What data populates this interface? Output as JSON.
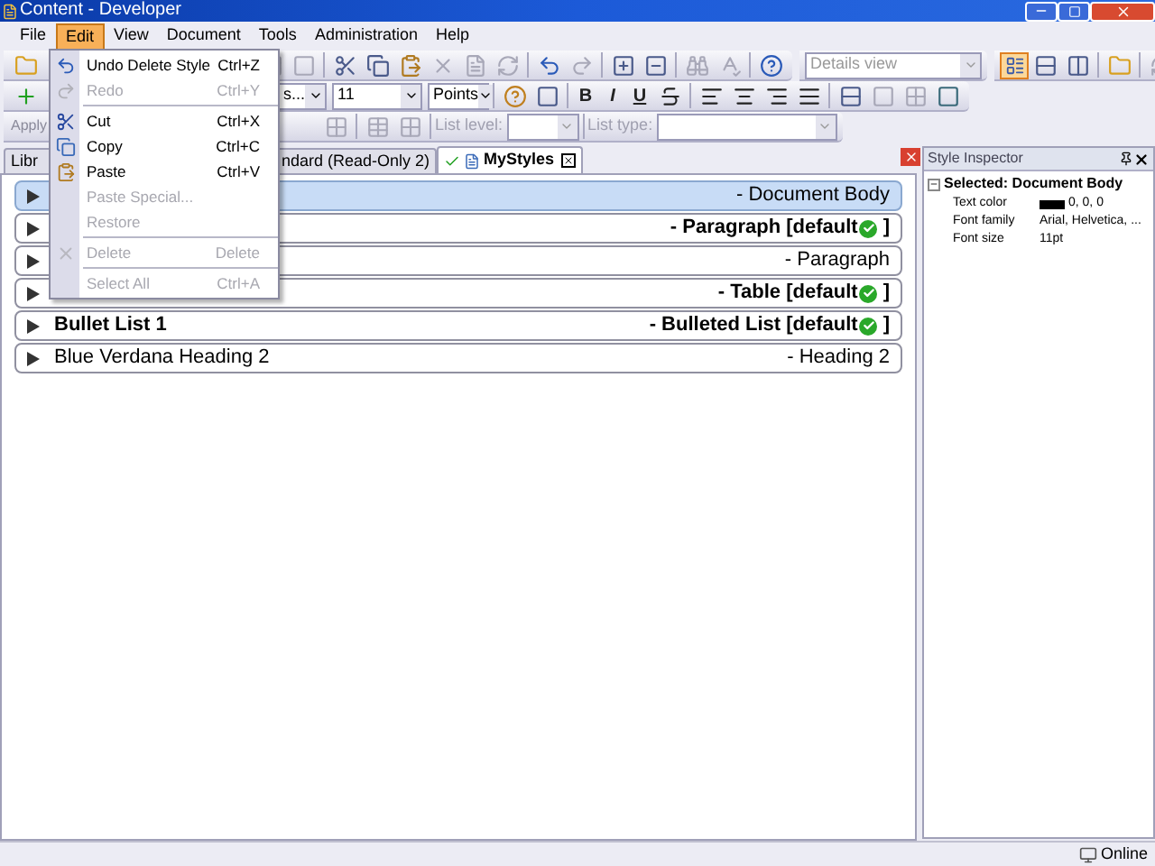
{
  "window": {
    "title": "Content - Developer"
  },
  "menu_bar": [
    {
      "label": "File",
      "selected": false
    },
    {
      "label": "Edit",
      "selected": true
    },
    {
      "label": "View",
      "selected": false
    },
    {
      "label": "Document",
      "selected": false
    },
    {
      "label": "Tools",
      "selected": false
    },
    {
      "label": "Administration",
      "selected": false
    },
    {
      "label": "Help",
      "selected": false
    }
  ],
  "edit_menu": [
    {
      "label": "Undo Delete Style",
      "shortcut": "Ctrl+Z",
      "disabled": false,
      "kind": "undo",
      "separator_before": false
    },
    {
      "label": "Redo",
      "shortcut": "Ctrl+Y",
      "disabled": true,
      "kind": "redo",
      "separator_before": false
    },
    {
      "label": "Cut",
      "shortcut": "Ctrl+X",
      "disabled": false,
      "kind": "cut",
      "separator_before": true
    },
    {
      "label": "Copy",
      "shortcut": "Ctrl+C",
      "disabled": false,
      "kind": "copy",
      "separator_before": false
    },
    {
      "label": "Paste",
      "shortcut": "Ctrl+V",
      "disabled": false,
      "kind": "paste",
      "separator_before": false
    },
    {
      "label": "Paste Special...",
      "disabled": true,
      "kind": "plain",
      "separator_before": false
    },
    {
      "label": "Restore",
      "disabled": true,
      "kind": "plain",
      "separator_before": false
    },
    {
      "label": "Delete",
      "shortcut": "Delete",
      "disabled": true,
      "kind": "delete",
      "separator_before": true
    },
    {
      "label": "Select All",
      "shortcut": "Ctrl+A",
      "disabled": true,
      "kind": "plain",
      "separator_before": true
    }
  ],
  "toolbar": {
    "view_mode": "Details view",
    "font_name": "s...",
    "font_size": "11",
    "size_unit": "Points",
    "format_buttons": [
      "B",
      "I",
      "U"
    ],
    "apply_button": "Apply",
    "list_level_label": "List level:",
    "list_type_label": "List type:"
  },
  "tabs": [
    {
      "label": "Libr",
      "selected": false
    },
    {
      "label": "ndard (Read-Only 2)",
      "selected": false
    },
    {
      "label": "MyStyles",
      "selected": true
    }
  ],
  "styles": [
    {
      "label": "- Document Body",
      "default": false,
      "selected": true
    },
    {
      "label": "- Paragraph [default",
      "suffix": "]",
      "default": true,
      "selected": false
    },
    {
      "label": "- Paragraph",
      "default": false,
      "selected": false
    },
    {
      "label": "- Table [default",
      "suffix": "]",
      "default": true,
      "selected": false
    },
    {
      "name": "Bullet List 1",
      "label": "- Bulleted List [default",
      "suffix": "]",
      "default": true,
      "selected": false
    },
    {
      "name": "Blue Verdana Heading 2",
      "label": "- Heading 2",
      "default": false,
      "selected": false
    }
  ],
  "style_inspector": {
    "title": "Style Inspector",
    "section": "Selected: Document Body",
    "properties": [
      {
        "name": "Text color",
        "value": "0, 0, 0",
        "color": "#000000"
      },
      {
        "name": "Font family",
        "value": "Arial, Helvetica, ..."
      },
      {
        "name": "Font size",
        "value": "11pt"
      }
    ]
  },
  "status_bar": {
    "status": "Online"
  }
}
